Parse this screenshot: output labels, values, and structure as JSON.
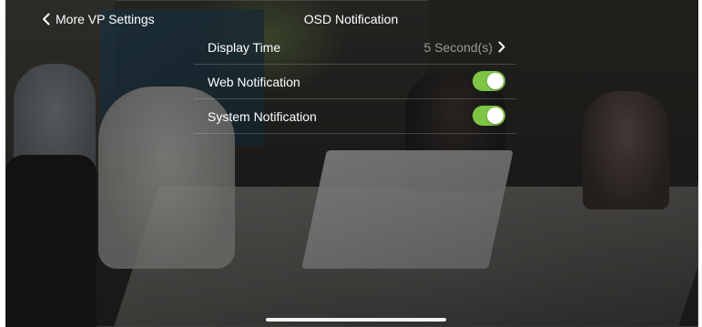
{
  "nav": {
    "back_label": "More VP Settings",
    "title": "OSD Notification"
  },
  "settings": {
    "display_time": {
      "label": "Display Time",
      "value": "5 Second(s)"
    },
    "web_notification": {
      "label": "Web Notification",
      "enabled": true
    },
    "system_notification": {
      "label": "System Notification",
      "enabled": true
    }
  },
  "colors": {
    "toggle_on": "#7ec545",
    "value_text": "#9a9994"
  },
  "icons": {
    "back": "chevron-left-icon",
    "disclosure": "chevron-right-icon"
  }
}
